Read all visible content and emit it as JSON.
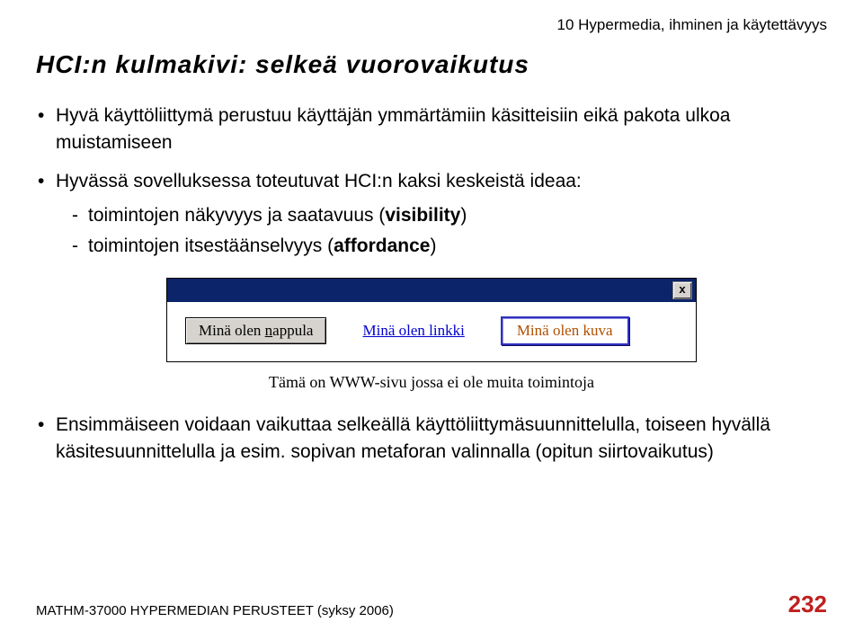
{
  "header": {
    "chapter": "10 Hypermedia, ihminen ja käytettävyys"
  },
  "title": "HCI:n kulmakivi: selkeä vuorovaikutus",
  "bullets": [
    {
      "text": "Hyvä käyttöliittymä perustuu käyttäjän ymmärtämiin käsitteisiin eikä pakota ulkoa muistamiseen"
    },
    {
      "text": "Hyvässä sovelluksessa toteutuvat HCI:n kaksi keskeistä ideaa:",
      "sub": [
        {
          "plain": "toimintojen näkyvyys ja saatavuus (",
          "bold": "visibility",
          "after": ")"
        },
        {
          "plain": "toimintojen itsestäänselvyys (",
          "bold": "affordance",
          "after": ")"
        }
      ]
    },
    {
      "text": "Ensimmäiseen voidaan vaikuttaa selkeällä käyttöliittymäsuunnittelulla, toiseen hyvällä käsitesuunnittelulla ja esim. sopivan metaforan valinnalla (opitun siirtovaikutus)"
    }
  ],
  "window": {
    "close_label": "x",
    "button_prefix": "Minä olen ",
    "button_underlined": "n",
    "button_suffix": "appula",
    "link_label": "Minä olen linkki",
    "image_label": "Minä olen kuva",
    "caption": "Tämä on WWW-sivu jossa ei ole muita toimintoja"
  },
  "footer": {
    "course": "MATHM-37000 HYPERMEDIAN PERUSTEET (syksy 2006)",
    "page": "232"
  }
}
